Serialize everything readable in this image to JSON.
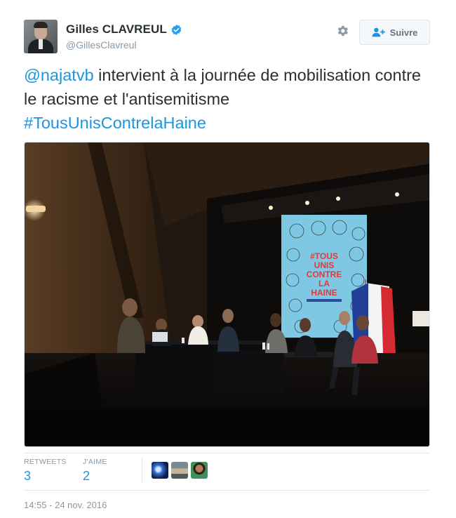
{
  "user": {
    "display_name": "Gilles CLAVREUL",
    "handle": "@GillesClavreul",
    "verified": true
  },
  "header": {
    "follow_label": "Suivre",
    "settings_icon": "gear-icon",
    "follow_icon": "add-user-icon"
  },
  "tweet": {
    "mention": "@najatvb",
    "text_part1": " intervient à la journée de mobilisation contre le racisme et l'antisemitisme",
    "hashtag": "#TousUnisContrelaHaine"
  },
  "photo": {
    "poster_lines": [
      "#TOUS",
      "UNIS",
      "CONTRE",
      "LA",
      "HAINE"
    ]
  },
  "stats": {
    "retweets_label": "RETWEETS",
    "retweets_count": "3",
    "likes_label": "J'AIME",
    "likes_count": "2"
  },
  "timestamp": "14:55 - 24 nov. 2016",
  "colors": {
    "link": "#1b95e0",
    "text": "#292f33",
    "muted": "#8899a6",
    "poster_bg": "#7ec8e3",
    "poster_title": "#e23a3a"
  }
}
